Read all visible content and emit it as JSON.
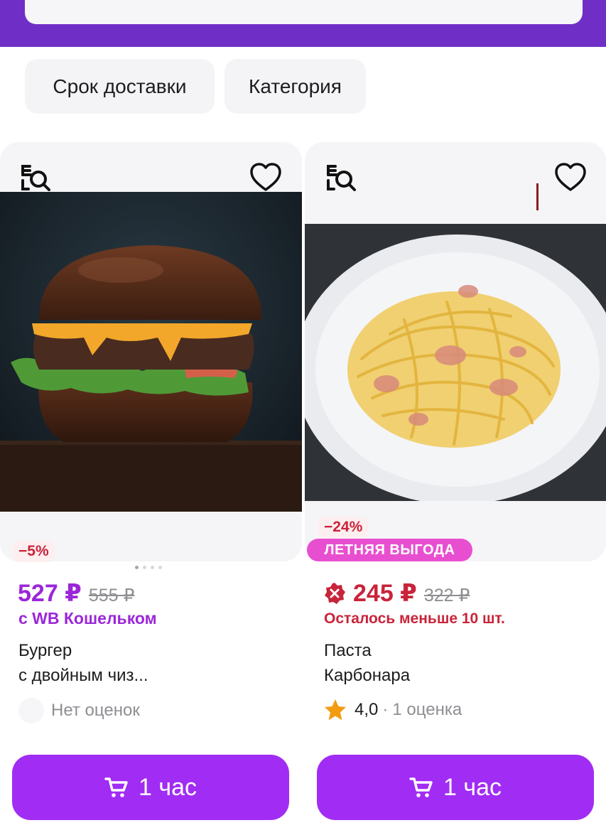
{
  "filters": {
    "delivery_label": "Срок доставки",
    "category_label": "Категория"
  },
  "products": [
    {
      "discount": "−5%",
      "price": "527 ₽",
      "old_price": "555 ₽",
      "wallet_note": "с WB Кошельком",
      "name_line1": "Бургер",
      "name_line2": "с двойным чиз...",
      "rating_text": "Нет оценок",
      "cart_label": "1 час"
    },
    {
      "discount": "−24%",
      "promo": "ЛЕТНЯЯ ВЫГОДА",
      "price": "245 ₽",
      "old_price": "322 ₽",
      "stock_note": "Осталось меньше 10 шт.",
      "name_line1": "Паста",
      "name_line2": "Карбонара",
      "rating_value": "4,0",
      "rating_sep": "·",
      "rating_count": "1 оценка",
      "cart_label": "1 час"
    }
  ],
  "colors": {
    "brand_purple": "#6f2fc7",
    "button_purple": "#a12cf3",
    "wallet_purple": "#9b27d8",
    "sale_red": "#c8243a",
    "promo_pink": "#e84fd0",
    "star": "#f39c12"
  },
  "icons": [
    "image-search-icon",
    "heart-icon",
    "cart-icon",
    "alert-badge-icon",
    "star-icon"
  ]
}
